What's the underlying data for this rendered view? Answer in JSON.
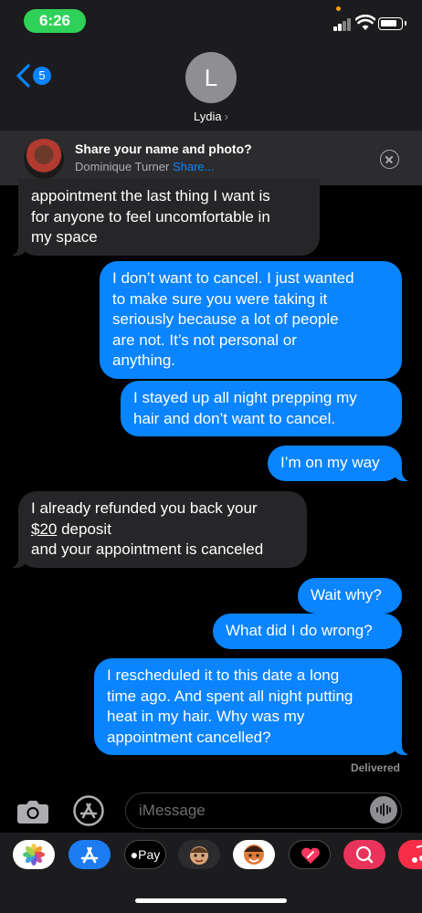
{
  "status": {
    "time": "6:26"
  },
  "header": {
    "back_count": "5",
    "avatar_initial": "L",
    "contact_name": "Lydia",
    "chevron": "›"
  },
  "share": {
    "title": "Share your name and photo?",
    "name": "Dominique Turner",
    "link": "Share..."
  },
  "messages": [
    {
      "from": "them",
      "text": "appointment the last thing I want is\nfor anyone to feel uncomfortable in\nmy space"
    },
    {
      "from": "me",
      "text": "I don’t want to cancel. I just wanted\nto make sure you were taking it\nseriously because a lot of people\nare not. It’s not personal or\nanything."
    },
    {
      "from": "me",
      "text": "I stayed up all night prepping my\nhair and don’t want to cancel."
    },
    {
      "from": "me",
      "text": "I’m on my way"
    },
    {
      "from": "them",
      "text_a": "I already refunded you back your",
      "text_b": "$20",
      "text_c": " deposit\nand your appointment is canceled"
    },
    {
      "from": "me",
      "text": "Wait why?"
    },
    {
      "from": "me",
      "text": "What did I do wrong?"
    },
    {
      "from": "me",
      "text": "I rescheduled it to this date a long\ntime ago. And spent all night putting\nheat in my hair. Why was my\nappointment cancelled?"
    }
  ],
  "delivered": "Delivered",
  "input": {
    "placeholder": "iMessage"
  },
  "apps": {
    "apple_pay": "Pay"
  },
  "colors": {
    "bubble_out": "#0a84ff",
    "bubble_in": "#262628",
    "status_green": "#30d158"
  }
}
